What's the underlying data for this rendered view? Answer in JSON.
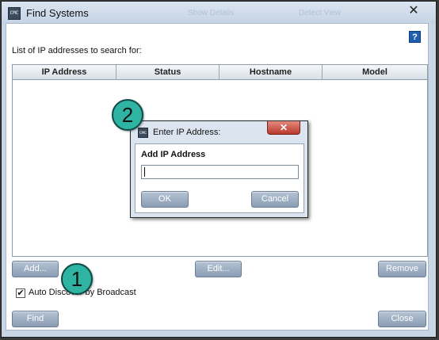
{
  "window": {
    "title": "Find Systems",
    "icon": "cmc-app-icon",
    "close_glyph": "✕"
  },
  "background_ghost": {
    "labels": [
      "Show Details",
      "Detect View"
    ]
  },
  "help": {
    "label": "?"
  },
  "list": {
    "label": "List of IP addresses to search for:",
    "columns": [
      "IP Address",
      "Status",
      "Hostname",
      "Model"
    ],
    "rows": []
  },
  "buttons": {
    "add": "Add...",
    "edit": "Edit...",
    "remove": "Remove",
    "find": "Find",
    "close": "Close"
  },
  "auto_discover": {
    "checked": true,
    "check_glyph": "✔",
    "label": "Auto Discover by Broadcast"
  },
  "badges": {
    "one": "1",
    "two": "2"
  },
  "dialog": {
    "title": "Enter IP Address:",
    "close_glyph": "✕",
    "heading": "Add IP Address",
    "input_value": "",
    "ok": "OK",
    "cancel": "Cancel"
  },
  "colors": {
    "badge": "#2fb3a2",
    "button": "#8b9db4",
    "close_red": "#b83a2c",
    "help_blue": "#1f5fb0"
  }
}
